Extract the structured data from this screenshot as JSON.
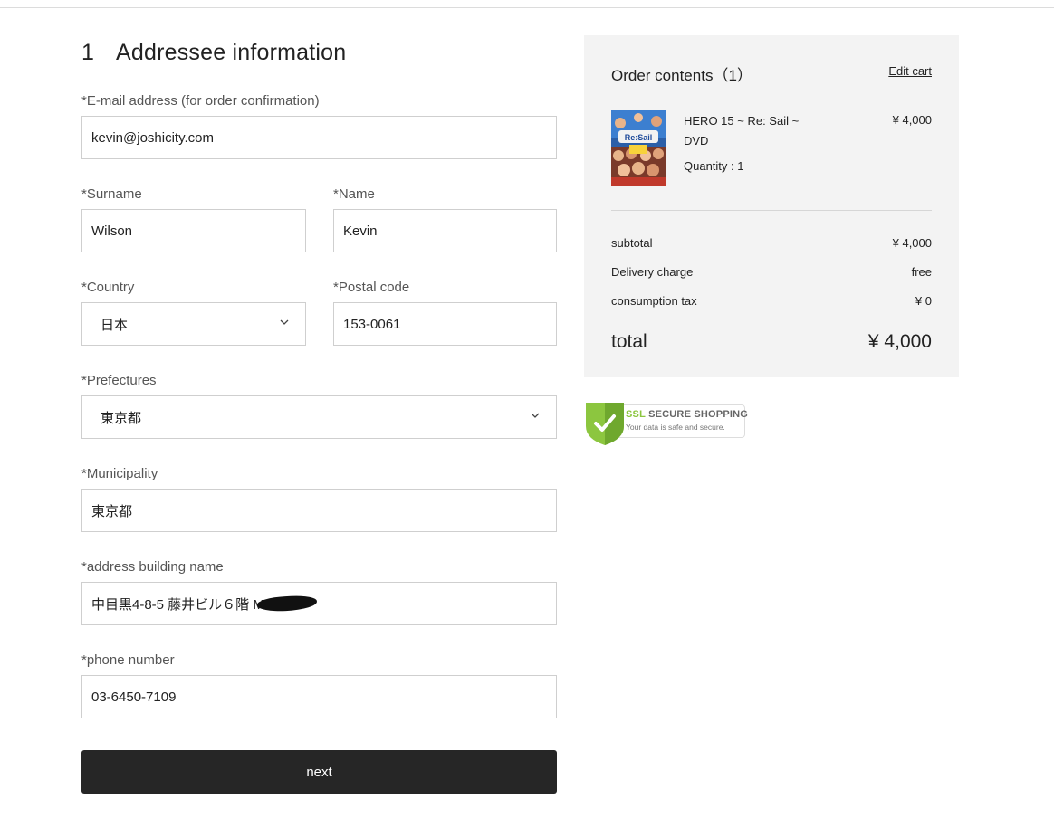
{
  "section": {
    "number": "1",
    "title": "Addressee information"
  },
  "form": {
    "email": {
      "label": "*E-mail address (for order confirmation)",
      "value": "kevin@joshicity.com"
    },
    "surname": {
      "label": "*Surname",
      "value": "Wilson"
    },
    "name": {
      "label": "*Name",
      "value": "Kevin"
    },
    "country": {
      "label": "*Country",
      "value": "日本"
    },
    "postal": {
      "label": "*Postal code",
      "value": "153-0061"
    },
    "prefecture": {
      "label": "*Prefectures",
      "value": "東京都"
    },
    "municipality": {
      "label": "*Municipality",
      "value": "東京都"
    },
    "address": {
      "label": "*address building name",
      "value": "中目黒4-8-5 藤井ビル６階 M"
    },
    "phone": {
      "label": "*phone number",
      "value": "03-6450-7109"
    },
    "next_label": "next"
  },
  "order": {
    "title": "Order contents（1）",
    "edit_cart": "Edit cart",
    "item": {
      "name": "HERO 15 ~ Re: Sail ~ DVD",
      "quantity": "Quantity : 1",
      "price": "¥ 4,000",
      "thumb_text": "Re:Sail"
    },
    "subtotal": {
      "label": "subtotal",
      "value": "¥ 4,000"
    },
    "delivery": {
      "label": "Delivery charge",
      "value": "free"
    },
    "tax": {
      "label": "consumption tax",
      "value": "¥ 0"
    },
    "total": {
      "label": "total",
      "value": "¥ 4,000"
    }
  },
  "ssl_badge": {
    "ssl": "SSL",
    "secure": "SECURE SHOPPING",
    "subtitle": "Your data is safe and secure."
  },
  "colors": {
    "button_bg": "#262626",
    "panel_bg": "#f3f3f3",
    "badge_green": "#8cc63f"
  }
}
